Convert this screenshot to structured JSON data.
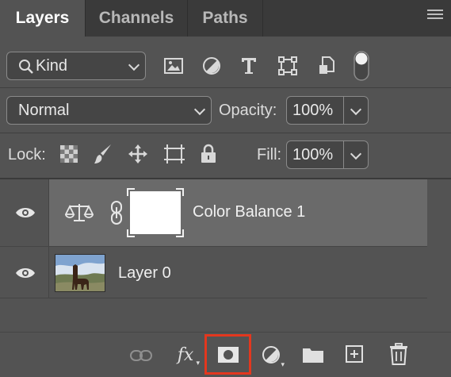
{
  "tabs": [
    {
      "label": "Layers",
      "active": true
    },
    {
      "label": "Channels",
      "active": false
    },
    {
      "label": "Paths",
      "active": false
    }
  ],
  "filter": {
    "kind_label": "Kind"
  },
  "blend": {
    "mode": "Normal",
    "opacity_label": "Opacity:",
    "opacity_value": "100%"
  },
  "lock": {
    "label": "Lock:",
    "fill_label": "Fill:",
    "fill_value": "100%"
  },
  "layers": [
    {
      "name": "Color Balance 1",
      "type": "adjustment",
      "selected": true,
      "visible": true
    },
    {
      "name": "Layer 0",
      "type": "pixel",
      "selected": false,
      "visible": true
    }
  ],
  "footer_icons": [
    "link-layers-icon",
    "fx-icon",
    "add-mask-icon",
    "adjustment-layer-icon",
    "group-folder-icon",
    "new-layer-icon",
    "trash-icon"
  ],
  "colors": {
    "panel": "#535353",
    "selected_row": "#6a6a6a",
    "highlight": "#e3371e"
  }
}
